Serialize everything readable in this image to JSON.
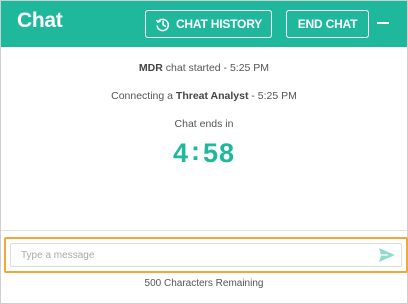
{
  "header": {
    "title": "Chat",
    "history_label": "CHAT HISTORY",
    "end_label": "END CHAT",
    "minimize_glyph": "–",
    "color": "#1fb89c"
  },
  "messages": {
    "line1_bold": "MDR",
    "line1_rest": " chat started - 5:25 PM",
    "line2_pre": "Connecting a ",
    "line2_bold": "Threat Analyst",
    "line2_post": " - 5:25 PM",
    "ends_label": "Chat ends in"
  },
  "timer": {
    "minutes": "4",
    "seconds": "58"
  },
  "input": {
    "placeholder": "Type a message",
    "value": "",
    "focus_color": "#f1a73a"
  },
  "footer": {
    "remaining": "500 Characters Remaining"
  }
}
